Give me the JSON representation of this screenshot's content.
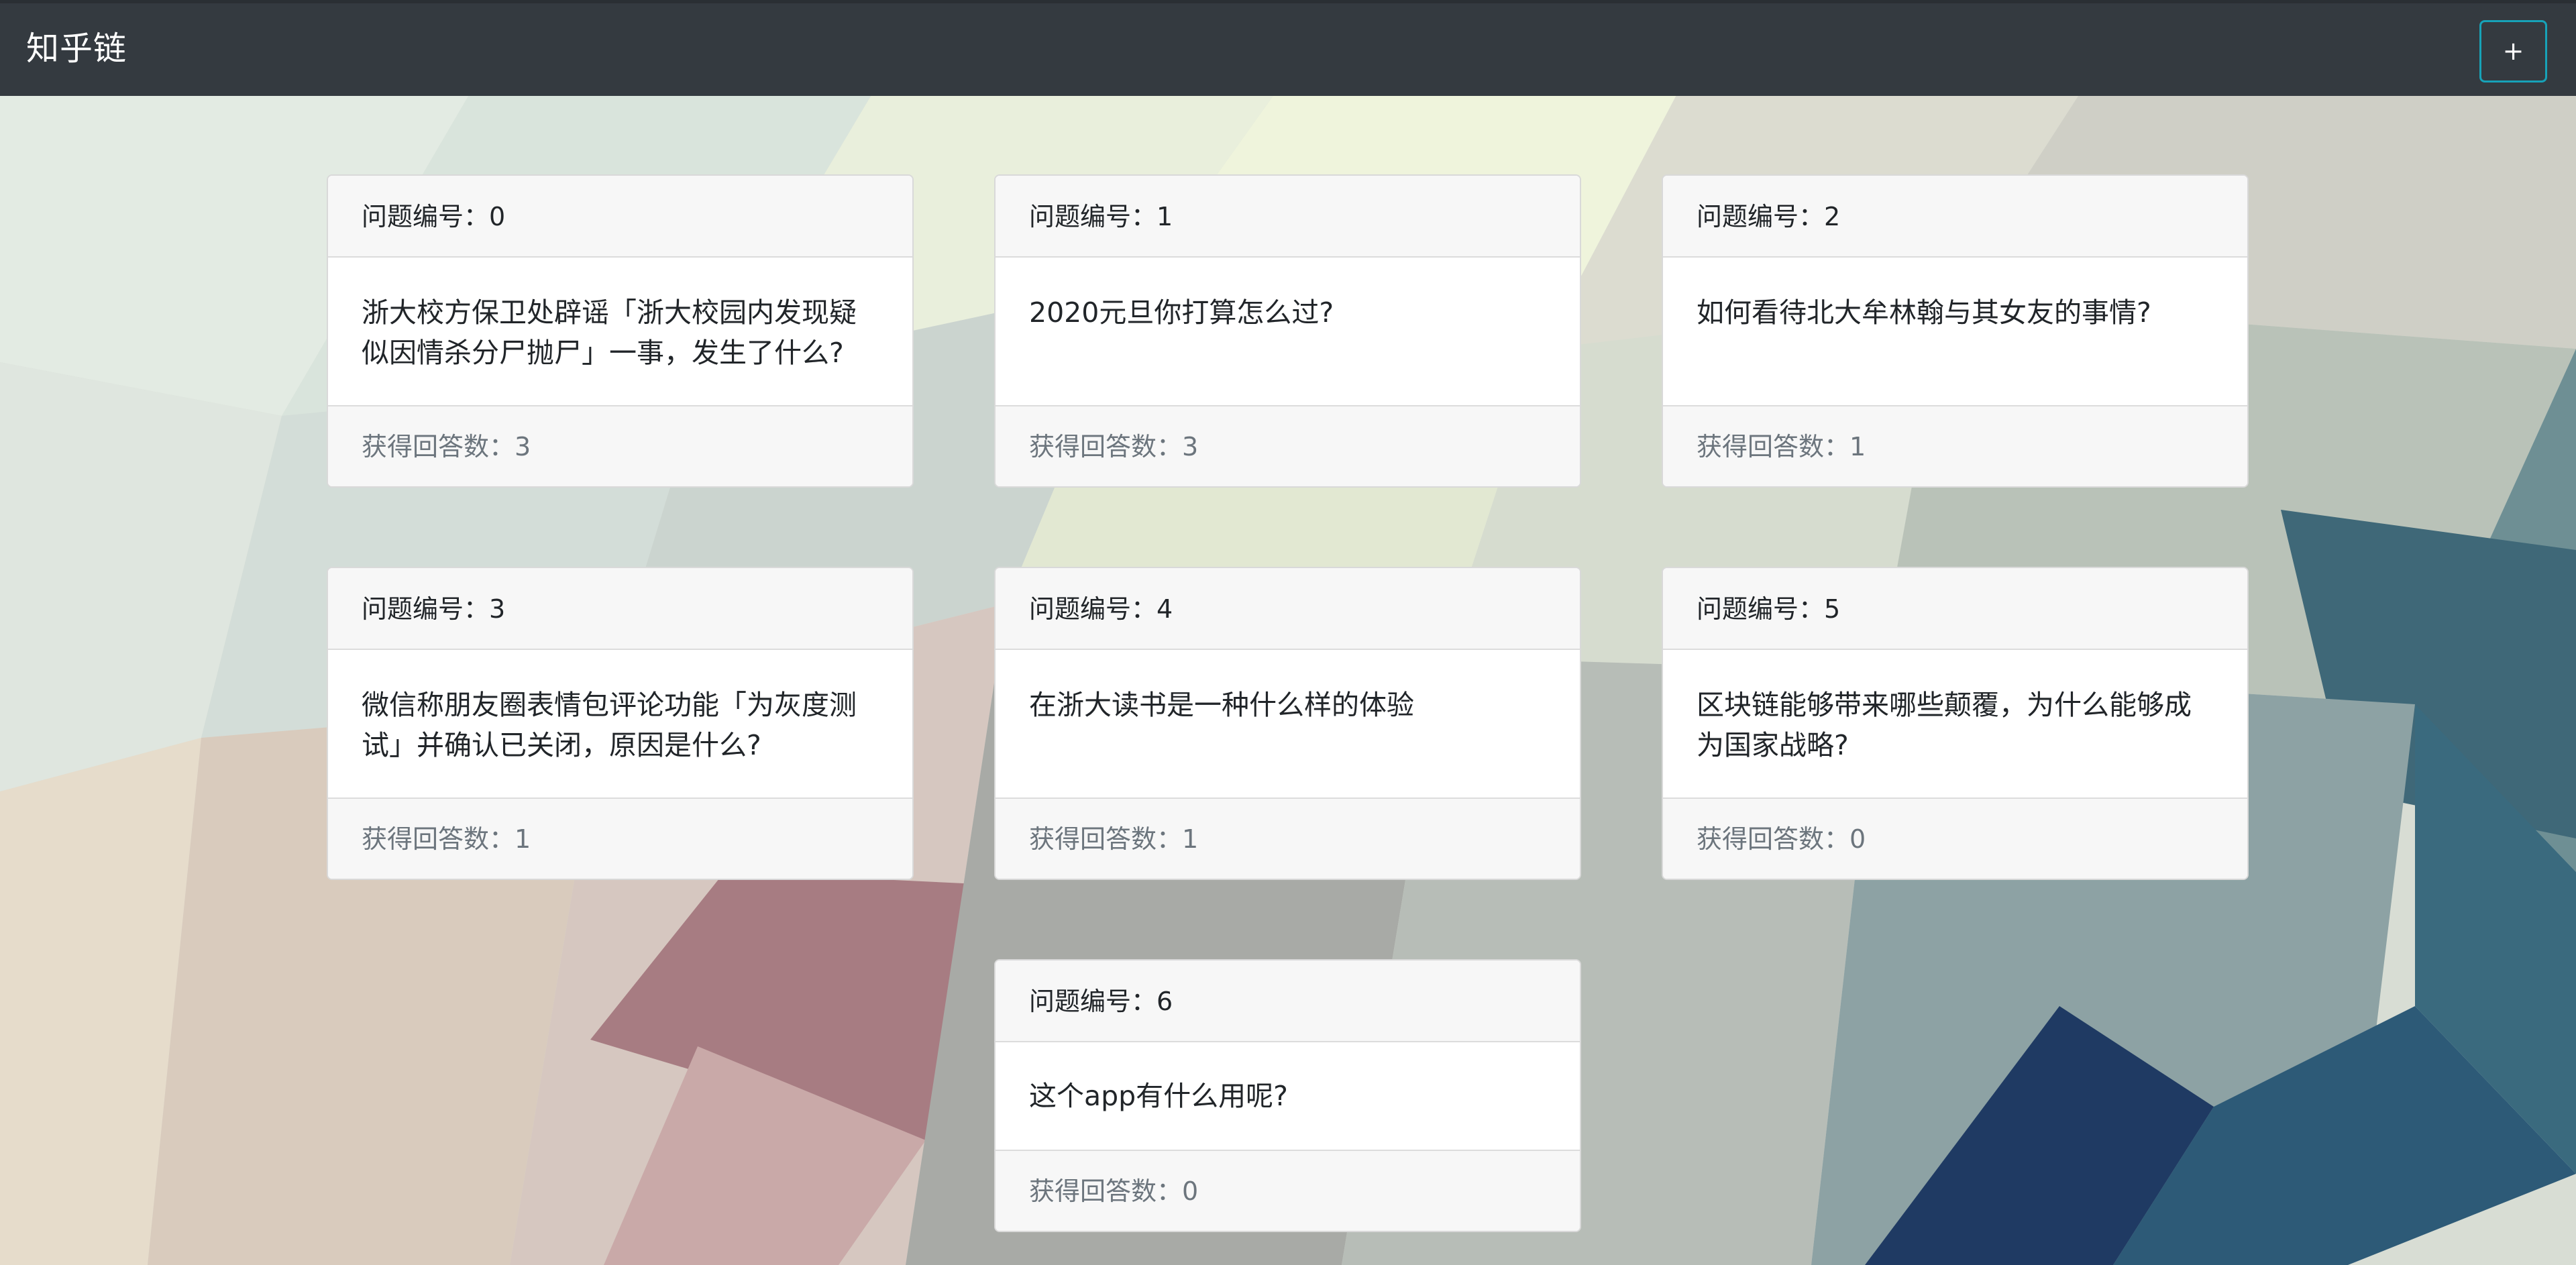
{
  "app": {
    "brand": "知乎链",
    "add_label": "+"
  },
  "questions": [
    {
      "id_label": "问题编号：0",
      "title": "浙大校方保卫处辟谣「浙大校园内发现疑似因情杀分尸抛尸」一事，发生了什么?",
      "answers_label": "获得回答数：3"
    },
    {
      "id_label": "问题编号：1",
      "title": "2020元旦你打算怎么过?",
      "answers_label": "获得回答数：3"
    },
    {
      "id_label": "问题编号：2",
      "title": "如何看待北大牟林翰与其女友的事情?",
      "answers_label": "获得回答数：1"
    },
    {
      "id_label": "问题编号：3",
      "title": "微信称朋友圈表情包评论功能「为灰度测试」并确认已关闭，原因是什么?",
      "answers_label": "获得回答数：1"
    },
    {
      "id_label": "问题编号：4",
      "title": "在浙大读书是一种什么样的体验",
      "answers_label": "获得回答数：1"
    },
    {
      "id_label": "问题编号：5",
      "title": "区块链能够带来哪些颠覆，为什么能够成为国家战略?",
      "answers_label": "获得回答数：0"
    },
    {
      "id_label": "问题编号：6",
      "title": "这个app有什么用呢?",
      "answers_label": "获得回答数：0"
    }
  ],
  "colors": {
    "navbar": "#343a40",
    "accent": "#17a2b8",
    "card_header": "#f7f7f7",
    "muted_text": "#6c757d"
  }
}
